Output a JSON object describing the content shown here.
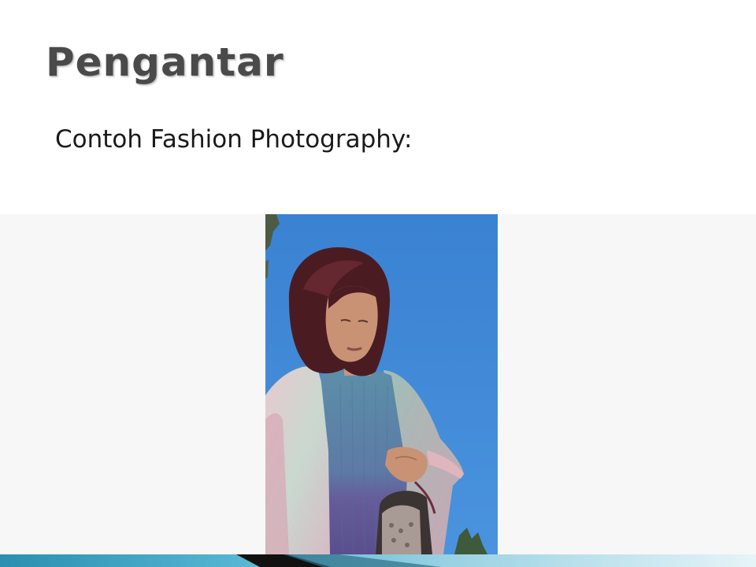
{
  "slide": {
    "title": "Pengantar",
    "subtitle": "Contoh Fashion Photography:"
  },
  "colors": {
    "title": "#4a4a4a",
    "sky": "#3f86d4",
    "hair": "#4a1c22",
    "accent_bar": "#2a8fb0"
  },
  "photo": {
    "icon": "fashion-photo"
  }
}
